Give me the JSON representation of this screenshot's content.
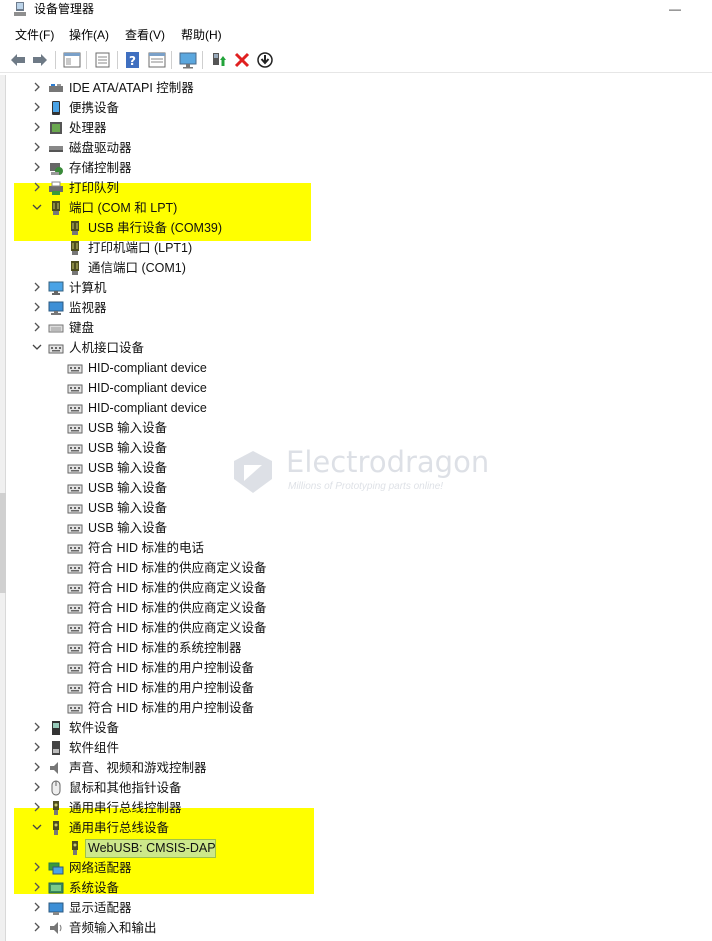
{
  "window": {
    "title": "设备管理器",
    "minimize": "—"
  },
  "menu": [
    "文件(F)",
    "操作(A)",
    "查看(V)",
    "帮助(H)"
  ],
  "toolbar": [
    "back-icon",
    "forward-icon",
    "properties-window-icon",
    "list-view-icon",
    "help-icon",
    "properties-icon",
    "monitor-scan-icon",
    "update-driver-icon",
    "uninstall-x-icon",
    "download-driver-icon"
  ],
  "tree": [
    {
      "label": "IDE ATA/ATAPI 控制器",
      "level": 1,
      "expander": ">",
      "icon": "ide-controller-icon"
    },
    {
      "label": "便携设备",
      "level": 1,
      "expander": ">",
      "icon": "portable-device-icon"
    },
    {
      "label": "处理器",
      "level": 1,
      "expander": ">",
      "icon": "processor-icon"
    },
    {
      "label": "磁盘驱动器",
      "level": 1,
      "expander": ">",
      "icon": "disk-drive-icon"
    },
    {
      "label": "存储控制器",
      "level": 1,
      "expander": ">",
      "icon": "storage-controller-icon"
    },
    {
      "label": "打印队列",
      "level": 1,
      "expander": ">",
      "icon": "printer-icon"
    },
    {
      "label": "端口 (COM 和 LPT)",
      "level": 1,
      "expander": "v",
      "icon": "port-icon"
    },
    {
      "label": "USB 串行设备 (COM39)",
      "level": 2,
      "icon": "port-icon"
    },
    {
      "label": "打印机端口 (LPT1)",
      "level": 2,
      "icon": "port-icon"
    },
    {
      "label": "通信端口 (COM1)",
      "level": 2,
      "icon": "port-icon"
    },
    {
      "label": "计算机",
      "level": 1,
      "expander": ">",
      "icon": "computer-icon"
    },
    {
      "label": "监视器",
      "level": 1,
      "expander": ">",
      "icon": "monitor-icon"
    },
    {
      "label": "键盘",
      "level": 1,
      "expander": ">",
      "icon": "keyboard-icon"
    },
    {
      "label": "人机接口设备",
      "level": 1,
      "expander": "v",
      "icon": "hid-icon"
    },
    {
      "label": "HID-compliant device",
      "level": 2,
      "icon": "hid-icon"
    },
    {
      "label": "HID-compliant device",
      "level": 2,
      "icon": "hid-icon"
    },
    {
      "label": "HID-compliant device",
      "level": 2,
      "icon": "hid-icon"
    },
    {
      "label": "USB 输入设备",
      "level": 2,
      "icon": "hid-icon"
    },
    {
      "label": "USB 输入设备",
      "level": 2,
      "icon": "hid-icon"
    },
    {
      "label": "USB 输入设备",
      "level": 2,
      "icon": "hid-icon"
    },
    {
      "label": "USB 输入设备",
      "level": 2,
      "icon": "hid-icon"
    },
    {
      "label": "USB 输入设备",
      "level": 2,
      "icon": "hid-icon"
    },
    {
      "label": "USB 输入设备",
      "level": 2,
      "icon": "hid-icon"
    },
    {
      "label": "符合 HID 标准的电话",
      "level": 2,
      "icon": "hid-icon"
    },
    {
      "label": "符合 HID 标准的供应商定义设备",
      "level": 2,
      "icon": "hid-icon"
    },
    {
      "label": "符合 HID 标准的供应商定义设备",
      "level": 2,
      "icon": "hid-icon"
    },
    {
      "label": "符合 HID 标准的供应商定义设备",
      "level": 2,
      "icon": "hid-icon"
    },
    {
      "label": "符合 HID 标准的供应商定义设备",
      "level": 2,
      "icon": "hid-icon"
    },
    {
      "label": "符合 HID 标准的系统控制器",
      "level": 2,
      "icon": "hid-icon"
    },
    {
      "label": "符合 HID 标准的用户控制设备",
      "level": 2,
      "icon": "hid-icon"
    },
    {
      "label": "符合 HID 标准的用户控制设备",
      "level": 2,
      "icon": "hid-icon"
    },
    {
      "label": "符合 HID 标准的用户控制设备",
      "level": 2,
      "icon": "hid-icon"
    },
    {
      "label": "软件设备",
      "level": 1,
      "expander": ">",
      "icon": "software-device-icon"
    },
    {
      "label": "软件组件",
      "level": 1,
      "expander": ">",
      "icon": "software-component-icon"
    },
    {
      "label": "声音、视频和游戏控制器",
      "level": 1,
      "expander": ">",
      "icon": "speaker-icon"
    },
    {
      "label": "鼠标和其他指针设备",
      "level": 1,
      "expander": ">",
      "icon": "mouse-icon"
    },
    {
      "label": "通用串行总线控制器",
      "level": 1,
      "expander": ">",
      "icon": "usb-icon"
    },
    {
      "label": "通用串行总线设备",
      "level": 1,
      "expander": "v",
      "icon": "usb-icon"
    },
    {
      "label": "WebUSB: CMSIS-DAP",
      "level": 2,
      "icon": "usb-icon",
      "selected": true
    },
    {
      "label": "网络适配器",
      "level": 1,
      "expander": ">",
      "icon": "network-adapter-icon"
    },
    {
      "label": "系统设备",
      "level": 1,
      "expander": ">",
      "icon": "system-device-icon"
    },
    {
      "label": "显示适配器",
      "level": 1,
      "expander": ">",
      "icon": "display-adapter-icon"
    },
    {
      "label": "音频输入和输出",
      "level": 1,
      "expander": ">",
      "icon": "audio-io-icon"
    }
  ],
  "watermark": {
    "name": "Electrodragon",
    "tagline": "Millions of Prototyping parts online!"
  },
  "colors": {
    "highlight": "#ffff00",
    "selection": "#cde88a"
  }
}
